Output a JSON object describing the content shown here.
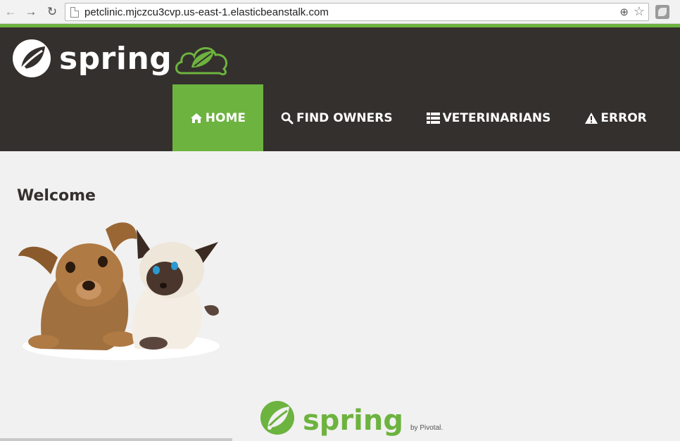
{
  "browser": {
    "url": "petclinic.mjczcu3cvp.us-east-1.elasticbeanstalk.com",
    "back_icon": "arrow-left-icon",
    "forward_icon": "arrow-right-icon",
    "reload_icon": "reload-icon"
  },
  "header": {
    "brand_text": "spring",
    "menu": [
      {
        "label": "HOME",
        "icon": "home-icon",
        "active": true
      },
      {
        "label": "FIND OWNERS",
        "icon": "search-icon",
        "active": false
      },
      {
        "label": "VETERINARIANS",
        "icon": "list-icon",
        "active": false
      },
      {
        "label": "ERROR",
        "icon": "warning-icon",
        "active": false
      }
    ]
  },
  "main": {
    "title": "Welcome"
  },
  "footer": {
    "brand_text": "spring",
    "by_text": "by Pivotal."
  },
  "colors": {
    "brand_green": "#6db33f",
    "navbar_dark": "#34302d",
    "page_bg": "#f1f1f1"
  }
}
